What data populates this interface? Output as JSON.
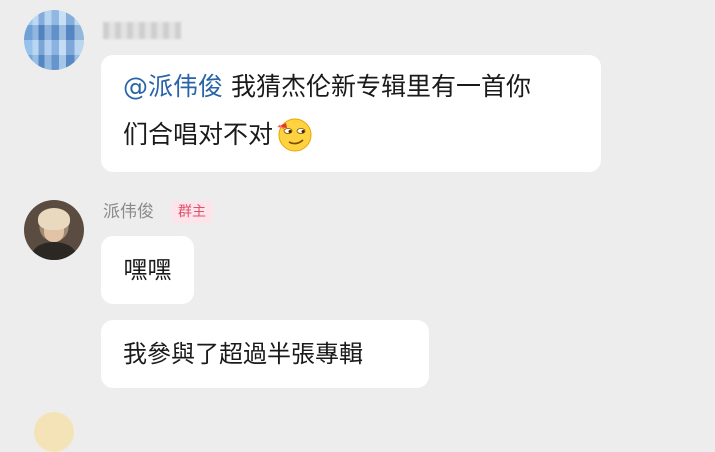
{
  "messages": [
    {
      "sender": "",
      "mention": "@派伟俊",
      "text_line1": "我猜杰伦新专辑里有一首你",
      "text_line2": "们合唱对不对",
      "emoji": "smirk-eyes-emoji"
    }
  ],
  "reply_group": {
    "sender": "派伟俊",
    "badge": "群主",
    "messages": [
      {
        "text": "嘿嘿"
      },
      {
        "text": "我參與了超過半張專輯"
      }
    ]
  },
  "colors": {
    "background": "#ededed",
    "bubble": "#ffffff",
    "mention": "#2a64a8",
    "sender_name": "#8a8a8a",
    "badge_text": "#e0516b",
    "badge_bg": "#fde4ea"
  }
}
